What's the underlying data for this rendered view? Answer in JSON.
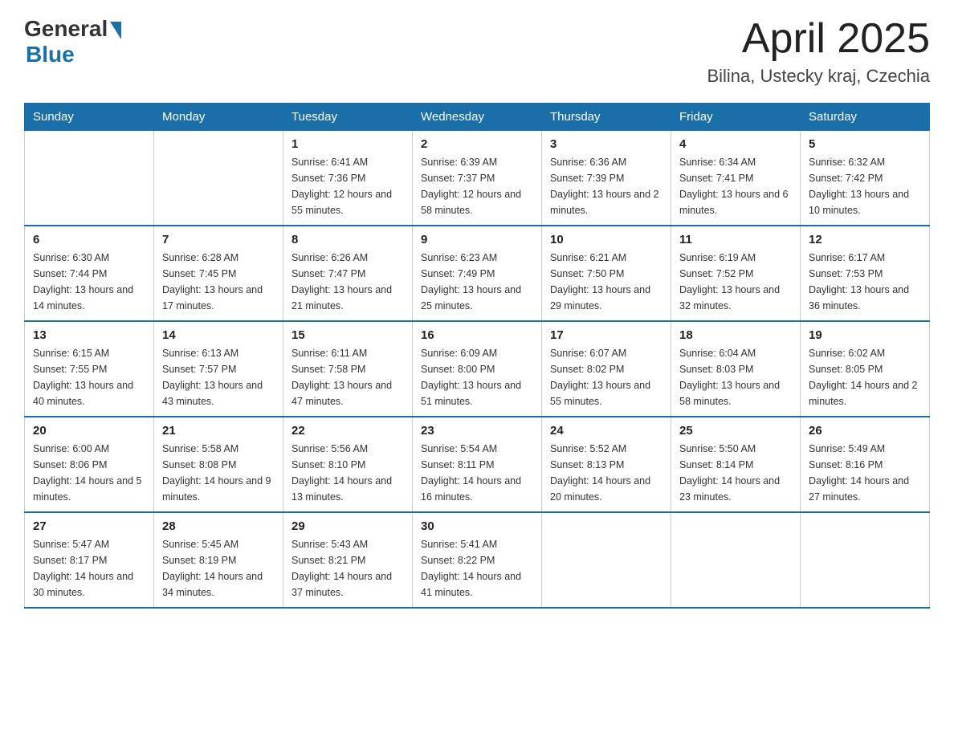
{
  "header": {
    "logo_general": "General",
    "logo_blue": "Blue",
    "month_title": "April 2025",
    "location": "Bilina, Ustecky kraj, Czechia"
  },
  "weekdays": [
    "Sunday",
    "Monday",
    "Tuesday",
    "Wednesday",
    "Thursday",
    "Friday",
    "Saturday"
  ],
  "weeks": [
    [
      {
        "day": "",
        "sunrise": "",
        "sunset": "",
        "daylight": ""
      },
      {
        "day": "",
        "sunrise": "",
        "sunset": "",
        "daylight": ""
      },
      {
        "day": "1",
        "sunrise": "Sunrise: 6:41 AM",
        "sunset": "Sunset: 7:36 PM",
        "daylight": "Daylight: 12 hours and 55 minutes."
      },
      {
        "day": "2",
        "sunrise": "Sunrise: 6:39 AM",
        "sunset": "Sunset: 7:37 PM",
        "daylight": "Daylight: 12 hours and 58 minutes."
      },
      {
        "day": "3",
        "sunrise": "Sunrise: 6:36 AM",
        "sunset": "Sunset: 7:39 PM",
        "daylight": "Daylight: 13 hours and 2 minutes."
      },
      {
        "day": "4",
        "sunrise": "Sunrise: 6:34 AM",
        "sunset": "Sunset: 7:41 PM",
        "daylight": "Daylight: 13 hours and 6 minutes."
      },
      {
        "day": "5",
        "sunrise": "Sunrise: 6:32 AM",
        "sunset": "Sunset: 7:42 PM",
        "daylight": "Daylight: 13 hours and 10 minutes."
      }
    ],
    [
      {
        "day": "6",
        "sunrise": "Sunrise: 6:30 AM",
        "sunset": "Sunset: 7:44 PM",
        "daylight": "Daylight: 13 hours and 14 minutes."
      },
      {
        "day": "7",
        "sunrise": "Sunrise: 6:28 AM",
        "sunset": "Sunset: 7:45 PM",
        "daylight": "Daylight: 13 hours and 17 minutes."
      },
      {
        "day": "8",
        "sunrise": "Sunrise: 6:26 AM",
        "sunset": "Sunset: 7:47 PM",
        "daylight": "Daylight: 13 hours and 21 minutes."
      },
      {
        "day": "9",
        "sunrise": "Sunrise: 6:23 AM",
        "sunset": "Sunset: 7:49 PM",
        "daylight": "Daylight: 13 hours and 25 minutes."
      },
      {
        "day": "10",
        "sunrise": "Sunrise: 6:21 AM",
        "sunset": "Sunset: 7:50 PM",
        "daylight": "Daylight: 13 hours and 29 minutes."
      },
      {
        "day": "11",
        "sunrise": "Sunrise: 6:19 AM",
        "sunset": "Sunset: 7:52 PM",
        "daylight": "Daylight: 13 hours and 32 minutes."
      },
      {
        "day": "12",
        "sunrise": "Sunrise: 6:17 AM",
        "sunset": "Sunset: 7:53 PM",
        "daylight": "Daylight: 13 hours and 36 minutes."
      }
    ],
    [
      {
        "day": "13",
        "sunrise": "Sunrise: 6:15 AM",
        "sunset": "Sunset: 7:55 PM",
        "daylight": "Daylight: 13 hours and 40 minutes."
      },
      {
        "day": "14",
        "sunrise": "Sunrise: 6:13 AM",
        "sunset": "Sunset: 7:57 PM",
        "daylight": "Daylight: 13 hours and 43 minutes."
      },
      {
        "day": "15",
        "sunrise": "Sunrise: 6:11 AM",
        "sunset": "Sunset: 7:58 PM",
        "daylight": "Daylight: 13 hours and 47 minutes."
      },
      {
        "day": "16",
        "sunrise": "Sunrise: 6:09 AM",
        "sunset": "Sunset: 8:00 PM",
        "daylight": "Daylight: 13 hours and 51 minutes."
      },
      {
        "day": "17",
        "sunrise": "Sunrise: 6:07 AM",
        "sunset": "Sunset: 8:02 PM",
        "daylight": "Daylight: 13 hours and 55 minutes."
      },
      {
        "day": "18",
        "sunrise": "Sunrise: 6:04 AM",
        "sunset": "Sunset: 8:03 PM",
        "daylight": "Daylight: 13 hours and 58 minutes."
      },
      {
        "day": "19",
        "sunrise": "Sunrise: 6:02 AM",
        "sunset": "Sunset: 8:05 PM",
        "daylight": "Daylight: 14 hours and 2 minutes."
      }
    ],
    [
      {
        "day": "20",
        "sunrise": "Sunrise: 6:00 AM",
        "sunset": "Sunset: 8:06 PM",
        "daylight": "Daylight: 14 hours and 5 minutes."
      },
      {
        "day": "21",
        "sunrise": "Sunrise: 5:58 AM",
        "sunset": "Sunset: 8:08 PM",
        "daylight": "Daylight: 14 hours and 9 minutes."
      },
      {
        "day": "22",
        "sunrise": "Sunrise: 5:56 AM",
        "sunset": "Sunset: 8:10 PM",
        "daylight": "Daylight: 14 hours and 13 minutes."
      },
      {
        "day": "23",
        "sunrise": "Sunrise: 5:54 AM",
        "sunset": "Sunset: 8:11 PM",
        "daylight": "Daylight: 14 hours and 16 minutes."
      },
      {
        "day": "24",
        "sunrise": "Sunrise: 5:52 AM",
        "sunset": "Sunset: 8:13 PM",
        "daylight": "Daylight: 14 hours and 20 minutes."
      },
      {
        "day": "25",
        "sunrise": "Sunrise: 5:50 AM",
        "sunset": "Sunset: 8:14 PM",
        "daylight": "Daylight: 14 hours and 23 minutes."
      },
      {
        "day": "26",
        "sunrise": "Sunrise: 5:49 AM",
        "sunset": "Sunset: 8:16 PM",
        "daylight": "Daylight: 14 hours and 27 minutes."
      }
    ],
    [
      {
        "day": "27",
        "sunrise": "Sunrise: 5:47 AM",
        "sunset": "Sunset: 8:17 PM",
        "daylight": "Daylight: 14 hours and 30 minutes."
      },
      {
        "day": "28",
        "sunrise": "Sunrise: 5:45 AM",
        "sunset": "Sunset: 8:19 PM",
        "daylight": "Daylight: 14 hours and 34 minutes."
      },
      {
        "day": "29",
        "sunrise": "Sunrise: 5:43 AM",
        "sunset": "Sunset: 8:21 PM",
        "daylight": "Daylight: 14 hours and 37 minutes."
      },
      {
        "day": "30",
        "sunrise": "Sunrise: 5:41 AM",
        "sunset": "Sunset: 8:22 PM",
        "daylight": "Daylight: 14 hours and 41 minutes."
      },
      {
        "day": "",
        "sunrise": "",
        "sunset": "",
        "daylight": ""
      },
      {
        "day": "",
        "sunrise": "",
        "sunset": "",
        "daylight": ""
      },
      {
        "day": "",
        "sunrise": "",
        "sunset": "",
        "daylight": ""
      }
    ]
  ]
}
